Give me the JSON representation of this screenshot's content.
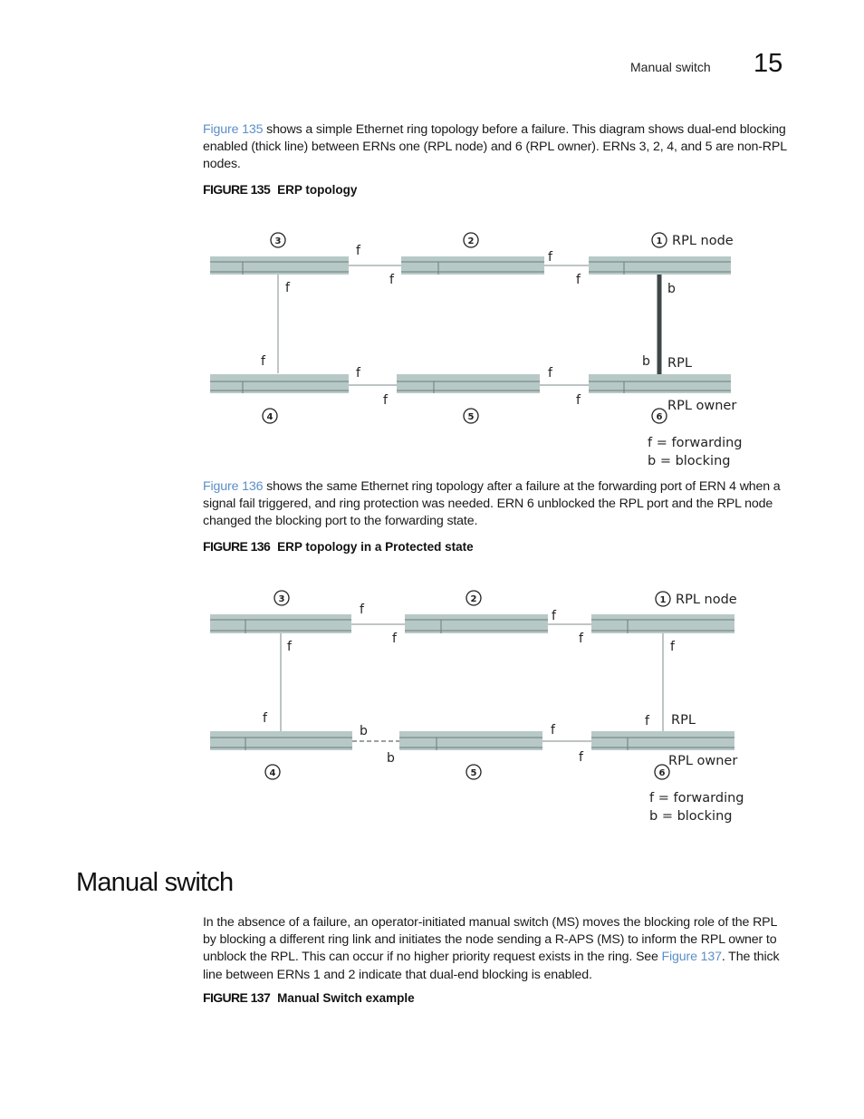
{
  "header": {
    "section_title": "Manual switch",
    "chapter_number": "15"
  },
  "paragraphs": {
    "p135": {
      "link": "Figure 135",
      "text": " shows a simple Ethernet ring topology before a failure. This diagram shows dual-end blocking enabled (thick line) between ERNs one (RPL node) and 6 (RPL owner). ERNs 3, 2, 4, and 5 are non-RPL nodes."
    },
    "p136": {
      "link": "Figure 136",
      "text": " shows the same Ethernet ring topology after a failure at the forwarding port of ERN 4 when a signal fail triggered, and ring protection was needed. ERN 6 unblocked the RPL port and the RPL node changed the blocking port to the forwarding state."
    },
    "p137": {
      "text_before": "In the absence of a failure, an operator-initiated manual switch (MS) moves the blocking role of the RPL by blocking a different ring link and initiates the node sending a R-APS (MS) to inform the RPL owner to unblock the RPL. This can occur if no higher priority request exists in the ring. See ",
      "link": "Figure 137",
      "text_after": ". The thick line between ERNs 1 and 2 indicate that dual-end blocking is enabled."
    }
  },
  "figures": {
    "fig135": {
      "number": "FIGURE 135",
      "title": "ERP topology",
      "nodes": {
        "n3": "3",
        "n2": "2",
        "n1": "1",
        "n4": "4",
        "n5": "5",
        "n6": "6"
      },
      "node_labels": {
        "rpl_node": "RPL node",
        "rpl": "RPL",
        "rpl_owner": "RPL owner"
      },
      "ports": {
        "n3_right": "f",
        "n2_left": "f",
        "n2_right": "f",
        "n1_left": "f",
        "n3_down": "f",
        "n4_up": "f",
        "n4_right": "f",
        "n5_left": "f",
        "n5_right": "f",
        "n6_left": "f",
        "n1_down": "b",
        "n6_up": "b"
      },
      "legend": {
        "f": "f = forwarding",
        "b": "b = blocking"
      }
    },
    "fig136": {
      "number": "FIGURE 136",
      "title": "ERP topology in a Protected state",
      "nodes": {
        "n3": "3",
        "n2": "2",
        "n1": "1",
        "n4": "4",
        "n5": "5",
        "n6": "6"
      },
      "node_labels": {
        "rpl_node": "RPL node",
        "rpl": "RPL",
        "rpl_owner": "RPL owner"
      },
      "ports": {
        "n3_right": "f",
        "n2_left": "f",
        "n2_right": "f",
        "n1_left": "f",
        "n3_down": "f",
        "n4_up": "f",
        "n4_right": "b",
        "n5_left": "b",
        "n5_right": "f",
        "n6_left": "f",
        "n1_down": "f",
        "n6_up": "f"
      },
      "legend": {
        "f": "f = forwarding",
        "b": "b = blocking"
      }
    },
    "fig137": {
      "number": "FIGURE 137",
      "title": "Manual Switch example"
    }
  },
  "section": {
    "title": "Manual switch"
  },
  "colors": {
    "link": "#5b8fc7",
    "switch_fill": "#b7c9c7",
    "switch_line": "#6d7a78",
    "forward_link": "#bfc5c5",
    "blocked_link": "#3f4647"
  }
}
